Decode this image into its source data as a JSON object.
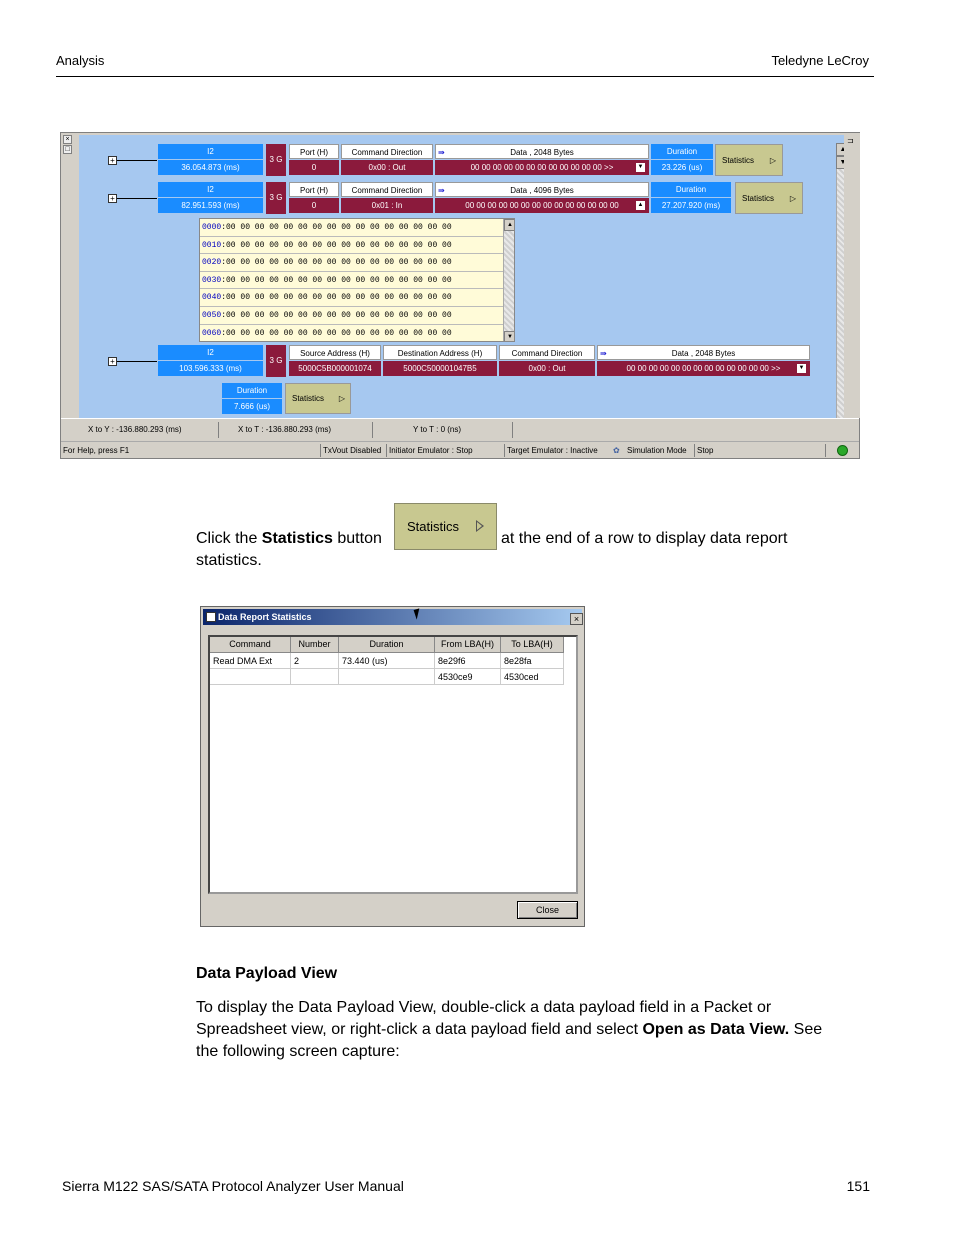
{
  "header": {
    "left": "Analysis",
    "right": "Teledyne LeCroy"
  },
  "footer": {
    "left": "Sierra M122 SAS/SATA Protocol Analyzer User Manual",
    "right": "151"
  },
  "screenshot": {
    "rows": [
      {
        "id": "I2",
        "time": "36.054.873 (ms)",
        "speed": "3 G",
        "port_label": "Port (H)",
        "port": "0",
        "cmd_label": "Command Direction",
        "cmd": "0x00 : Out",
        "data_label": "Data , 2048 Bytes",
        "data": "00 00 00 00 00 00 00 00 00 00 00 00  >>",
        "dur_label": "Duration",
        "dur": "23.226 (us)",
        "stats": "Statistics"
      },
      {
        "id": "I2",
        "time": "82.951.593 (ms)",
        "speed": "3 G",
        "port_label": "Port (H)",
        "port": "0",
        "cmd_label": "Command Direction",
        "cmd": "0x01 : In",
        "data_label": "Data , 4096 Bytes",
        "data": "00 00 00 00 00 00 00 00 00 00 00 00 00 00",
        "dur_label": "Duration",
        "dur": "27.207.920 (ms)",
        "stats": "Statistics"
      }
    ],
    "hex_rows": [
      {
        "off": "0000",
        "bytes": ":00 00 00 00 00 00 00 00 00 00 00 00 00 00 00 00"
      },
      {
        "off": "0010",
        "bytes": ":00 00 00 00 00 00 00 00 00 00 00 00 00 00 00 00"
      },
      {
        "off": "0020",
        "bytes": ":00 00 00 00 00 00 00 00 00 00 00 00 00 00 00 00"
      },
      {
        "off": "0030",
        "bytes": ":00 00 00 00 00 00 00 00 00 00 00 00 00 00 00 00"
      },
      {
        "off": "0040",
        "bytes": ":00 00 00 00 00 00 00 00 00 00 00 00 00 00 00 00"
      },
      {
        "off": "0050",
        "bytes": ":00 00 00 00 00 00 00 00 00 00 00 00 00 00 00 00"
      },
      {
        "off": "0060",
        "bytes": ":00 00 00 00 00 00 00 00 00 00 00 00 00 00 00 00"
      }
    ],
    "row3": {
      "id": "I2",
      "time": "103.596.333 (ms)",
      "speed": "3 G",
      "src_label": "Source Address (H)",
      "src": "5000C5B000001074",
      "dst_label": "Destination Address (H)",
      "dst": "5000C500001047B5",
      "cmd_label": "Command Direction",
      "cmd": "0x00 : Out",
      "data_label": "Data , 2048 Bytes",
      "data": "00 00 00 00 00 00 00 00 00 00 00 00 00  >>",
      "dur_label": "Duration",
      "dur": "7.666 (us)",
      "stats": "Statistics"
    },
    "status1": {
      "xy": "X to Y : -136.880.293 (ms)",
      "xt": "X to T : -136.880.293 (ms)",
      "yt": "Y to T : 0 (ns)"
    },
    "status2": {
      "help": "For Help, press F1",
      "txvout": "TxVout Disabled",
      "init": "Initiator Emulator : Stop",
      "target": "Target Emulator : Inactive",
      "sim": "Simulation Mode",
      "stop": "Stop"
    }
  },
  "para1": {
    "pre": "Click the ",
    "bold": "Statistics",
    "mid": " button",
    "post": " at the end of a row to display data report",
    "line2": "statistics."
  },
  "inline_button": {
    "label": "Statistics"
  },
  "dialog": {
    "title": "Data Report Statistics",
    "close_x": "×",
    "columns": [
      "Command",
      "Number",
      "Duration",
      "From LBA(H)",
      "To LBA(H)"
    ],
    "rows": [
      [
        "Read DMA Ext",
        "2",
        "73.440 (us)",
        "8e29f6",
        "8e28fa"
      ],
      [
        "",
        "",
        "",
        "4530ce9",
        "4530ced"
      ]
    ],
    "close_button": "Close"
  },
  "section_title": "Data Payload View",
  "para2": {
    "line1": "To display the Data Payload View, double-click a data payload field in a Packet or",
    "line2_pre": "Spreadsheet view, or right-click a data payload field and select ",
    "line2_bold": "Open as Data View.",
    "line2_post": " See",
    "line3": "the following screen capture:"
  }
}
